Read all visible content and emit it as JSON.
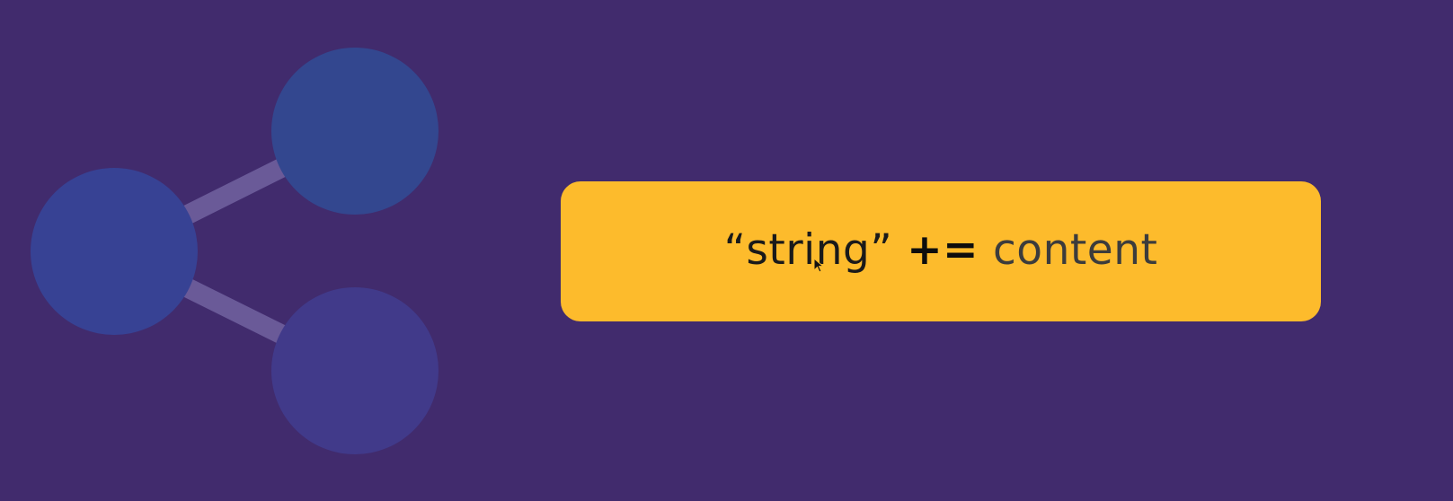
{
  "slide": {
    "background_color": "#412b6d",
    "share_graphic": {
      "icon": "share-icon",
      "node_color": "#3a4490",
      "edge_color": "#6a5a98"
    },
    "expression_card": {
      "background_color": "#fdbb2c",
      "string_token": "“string”",
      "operator_token": "+=",
      "content_token": "content"
    }
  },
  "cursor": {
    "icon": "mouse-pointer-icon"
  }
}
